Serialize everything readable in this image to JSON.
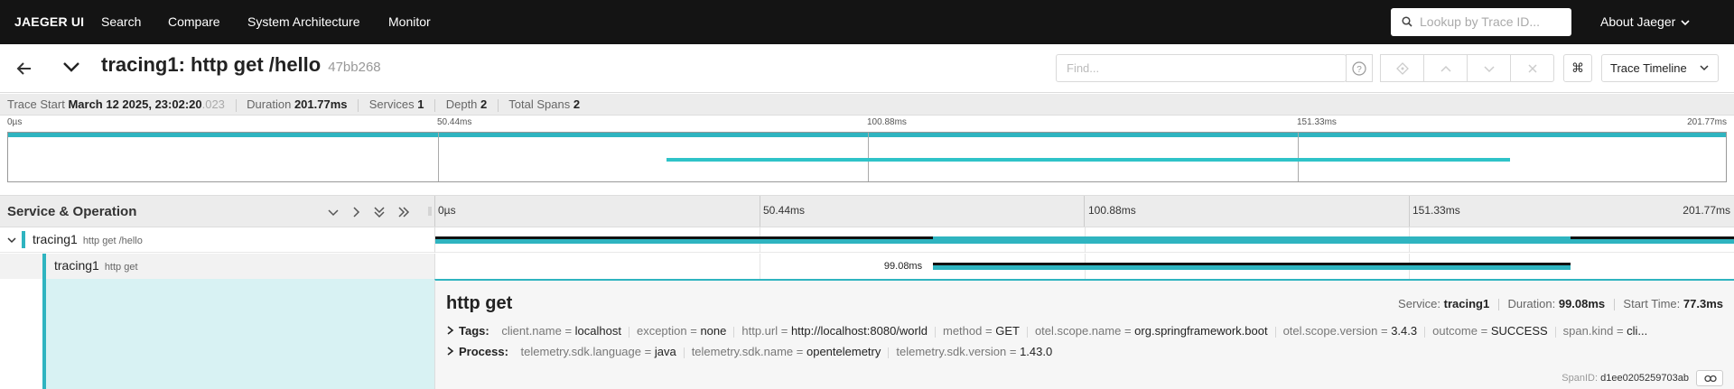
{
  "nav": {
    "brand": "JAEGER UI",
    "links": [
      "Search",
      "Compare",
      "System Architecture",
      "Monitor"
    ],
    "lookup_placeholder": "Lookup by Trace ID...",
    "about": "About Jaeger"
  },
  "trace": {
    "title": "tracing1: http get /hello",
    "trace_id": "47bb268",
    "find_placeholder": "Find...",
    "keyboard_glyph": "⌘",
    "view_select": "Trace Timeline"
  },
  "stats": {
    "start_label": "Trace Start",
    "start_value": "March 12 2025, 23:02:20",
    "start_ms": ".023",
    "duration_label": "Duration",
    "duration_value": "201.77ms",
    "services_label": "Services",
    "services_value": "1",
    "depth_label": "Depth",
    "depth_value": "2",
    "spans_label": "Total Spans",
    "spans_value": "2"
  },
  "ticks": [
    "0µs",
    "50.44ms",
    "100.88ms",
    "151.33ms",
    "201.77ms"
  ],
  "timeline": {
    "total_ms": 201.77,
    "header_title": "Service & Operation"
  },
  "spans": [
    {
      "service": "tracing1",
      "operation": "http get /hello",
      "start_ms": 0,
      "duration_ms": 201.77,
      "critical": [
        [
          0,
          77.3
        ],
        [
          176.4,
          201.77
        ]
      ],
      "color": "#2fb4c0"
    },
    {
      "service": "tracing1",
      "operation": "http get",
      "start_ms": 77.3,
      "duration_ms": 99.08,
      "duration_label": "99.08ms",
      "critical": [
        [
          77.3,
          176.38
        ]
      ],
      "color": "#2fb4c0"
    }
  ],
  "detail": {
    "title": "http get",
    "service_label": "Service:",
    "service": "tracing1",
    "duration_label": "Duration:",
    "duration": "99.08ms",
    "start_label": "Start Time:",
    "start": "77.3ms",
    "tags_label": "Tags:",
    "tags": [
      {
        "k": "client.name",
        "v": "localhost"
      },
      {
        "k": "exception",
        "v": "none"
      },
      {
        "k": "http.url",
        "v": "http://localhost:8080/world"
      },
      {
        "k": "method",
        "v": "GET"
      },
      {
        "k": "otel.scope.name",
        "v": "org.springframework.boot"
      },
      {
        "k": "otel.scope.version",
        "v": "3.4.3"
      },
      {
        "k": "outcome",
        "v": "SUCCESS"
      },
      {
        "k": "span.kind",
        "v": "cli..."
      }
    ],
    "process_label": "Process:",
    "process": [
      {
        "k": "telemetry.sdk.language",
        "v": "java"
      },
      {
        "k": "telemetry.sdk.name",
        "v": "opentelemetry"
      },
      {
        "k": "telemetry.sdk.version",
        "v": "1.43.0"
      }
    ],
    "spanid_label": "SpanID:",
    "spanid": "d1ee0205259703ab"
  }
}
